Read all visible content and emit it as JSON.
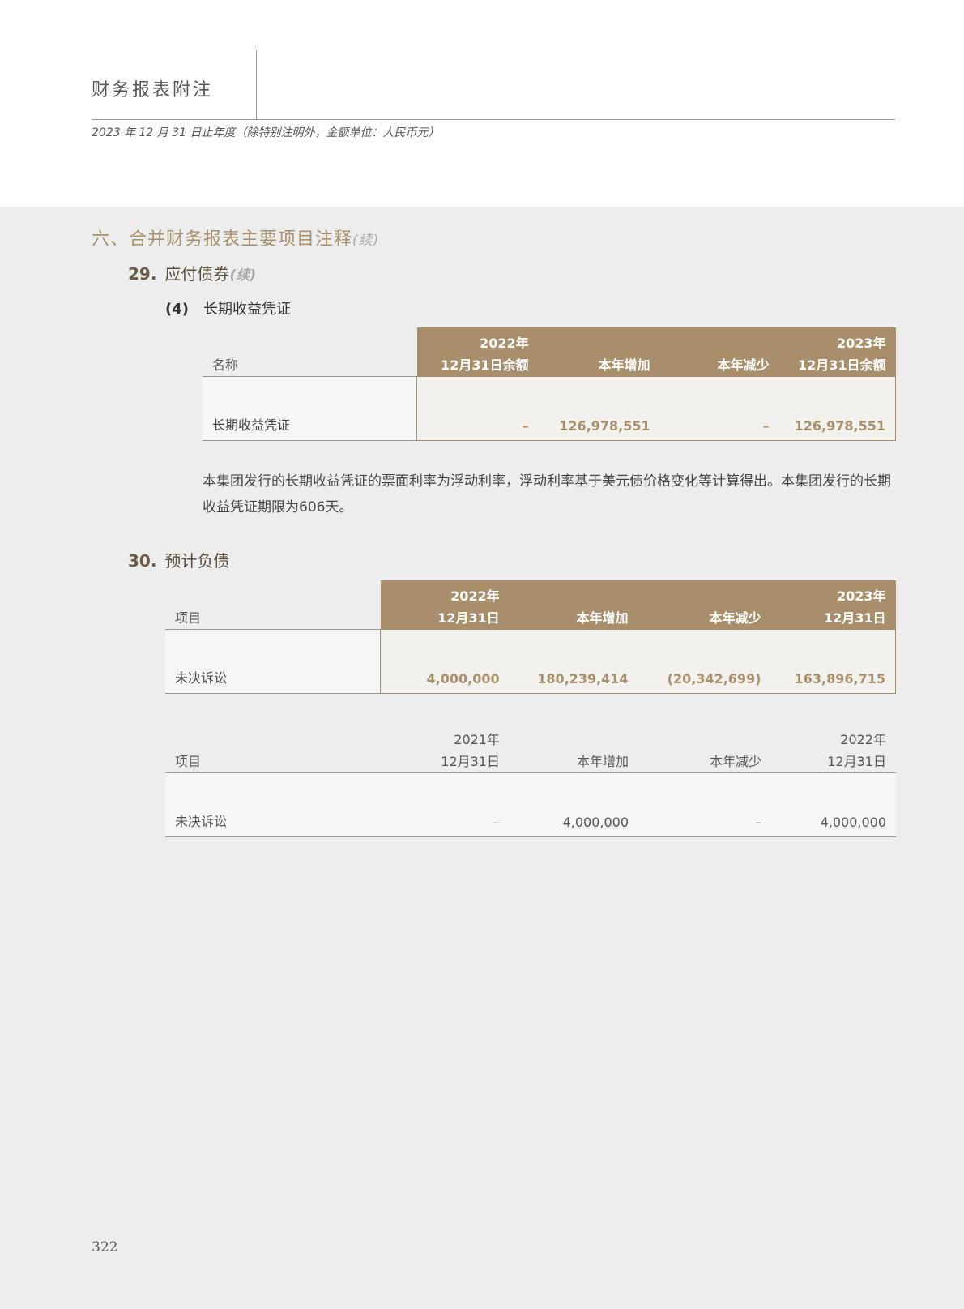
{
  "header": {
    "title": "财务报表附注",
    "subtitle": "2023 年 12 月 31 日止年度（除特别注明外，金额单位：人民币元）"
  },
  "section": {
    "title": "六、合并财务报表主要项目注释",
    "cont": "(续)"
  },
  "note29": {
    "num": "29.",
    "title": "应付债券",
    "cont": "(续)",
    "sub": {
      "num": "(4)",
      "title": "长期收益凭证"
    },
    "table": {
      "col_label": "名称",
      "col1_line1": "2022年",
      "col1_line2": "12月31日余额",
      "col2": "本年增加",
      "col3": "本年减少",
      "col4_line1": "2023年",
      "col4_line2": "12月31日余额",
      "row": {
        "label": "长期收益凭证",
        "v1": "–",
        "v2": "126,978,551",
        "v3": "–",
        "v4": "126,978,551"
      }
    },
    "paragraph": "本集团发行的长期收益凭证的票面利率为浮动利率，浮动利率基于美元债价格变化等计算得出。本集团发行的长期收益凭证期限为606天。"
  },
  "note30": {
    "num": "30.",
    "title": "预计负债",
    "table_2023": {
      "col_label": "项目",
      "col1_line1": "2022年",
      "col1_line2": "12月31日",
      "col2": "本年增加",
      "col3": "本年减少",
      "col4_line1": "2023年",
      "col4_line2": "12月31日",
      "row": {
        "label": "未决诉讼",
        "v1": "4,000,000",
        "v2": "180,239,414",
        "v3": "(20,342,699)",
        "v4": "163,896,715"
      }
    },
    "table_2022": {
      "col_label": "项目",
      "col1_line1": "2021年",
      "col1_line2": "12月31日",
      "col2": "本年增加",
      "col3": "本年减少",
      "col4_line1": "2022年",
      "col4_line2": "12月31日",
      "row": {
        "label": "未决诉讼",
        "v1": "–",
        "v2": "4,000,000",
        "v3": "–",
        "v4": "4,000,000"
      }
    }
  },
  "page_number": "322",
  "colors": {
    "gold": "#a88e6b",
    "gold_text": "#a8906c",
    "background": "#ededed"
  }
}
